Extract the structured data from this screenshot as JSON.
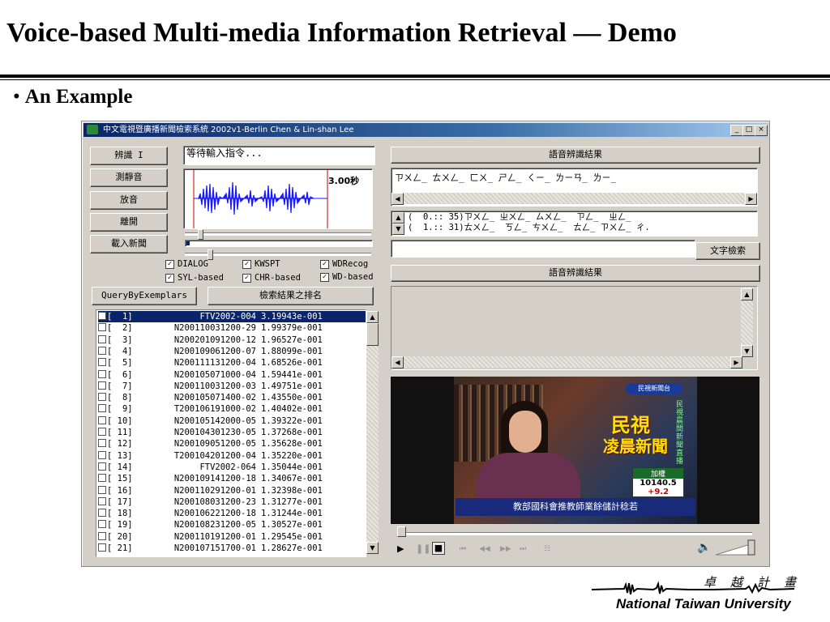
{
  "slide": {
    "title": "Voice-based Multi-media Information Retrieval — Demo",
    "bullet": "An Example"
  },
  "window": {
    "title": "中文電視暨廣播新聞檢索系統 2002v1-Berlin Chen & Lin-shan Lee",
    "controls": {
      "minimize": "_",
      "maximize": "□",
      "close": "×"
    }
  },
  "left_buttons": {
    "recognize": "辨識 I",
    "measure_silence": "測靜音",
    "play": "放音",
    "exit": "離開",
    "load_news": "載入新聞"
  },
  "status_text": "等待輸入指令...",
  "waveform": {
    "duration_label": "3.00秒"
  },
  "checkboxes": [
    {
      "label": "DIALOG",
      "checked": true
    },
    {
      "label": "KWSPT",
      "checked": true
    },
    {
      "label": "WDRecog",
      "checked": true
    },
    {
      "label": "SYL-based",
      "checked": true
    },
    {
      "label": "CHR-based",
      "checked": true
    },
    {
      "label": "WD-based",
      "checked": true
    }
  ],
  "query_button": "QueryByExemplars",
  "sort_button": "檢索結果之排名",
  "results": [
    {
      "n": "[  1]",
      "name": "FTV2002-004",
      "score": "3.19943e-001",
      "selected": true
    },
    {
      "n": "[  2]",
      "name": "N200110031200-29",
      "score": "1.99379e-001"
    },
    {
      "n": "[  3]",
      "name": "N200201091200-12",
      "score": "1.96527e-001"
    },
    {
      "n": "[  4]",
      "name": "N200109061200-07",
      "score": "1.88099e-001"
    },
    {
      "n": "[  5]",
      "name": "N200111131200-04",
      "score": "1.68526e-001"
    },
    {
      "n": "[  6]",
      "name": "N200105071000-04",
      "score": "1.59441e-001"
    },
    {
      "n": "[  7]",
      "name": "N200110031200-03",
      "score": "1.49751e-001"
    },
    {
      "n": "[  8]",
      "name": "N200105071400-02",
      "score": "1.43550e-001"
    },
    {
      "n": "[  9]",
      "name": "T200106191000-02",
      "score": "1.40402e-001"
    },
    {
      "n": "[ 10]",
      "name": "N200105142000-05",
      "score": "1.39322e-001"
    },
    {
      "n": "[ 11]",
      "name": "N200104301230-05",
      "score": "1.37268e-001"
    },
    {
      "n": "[ 12]",
      "name": "N200109051200-05",
      "score": "1.35628e-001"
    },
    {
      "n": "[ 13]",
      "name": "T200104201200-04",
      "score": "1.35220e-001"
    },
    {
      "n": "[ 14]",
      "name": "FTV2002-064",
      "score": "1.35044e-001"
    },
    {
      "n": "[ 15]",
      "name": "N200109141200-18",
      "score": "1.34067e-001"
    },
    {
      "n": "[ 16]",
      "name": "N200110291200-01",
      "score": "1.32398e-001"
    },
    {
      "n": "[ 17]",
      "name": "N200108031200-23",
      "score": "1.31277e-001"
    },
    {
      "n": "[ 18]",
      "name": "N200106221200-18",
      "score": "1.31244e-001"
    },
    {
      "n": "[ 19]",
      "name": "N200108231200-05",
      "score": "1.30527e-001"
    },
    {
      "n": "[ 20]",
      "name": "N200110191200-01",
      "score": "1.29545e-001"
    },
    {
      "n": "[ 21]",
      "name": "N200107151700-01",
      "score": "1.28627e-001"
    }
  ],
  "right": {
    "recog_header": "語音辨識結果",
    "zhuyin_line": "ㄗㄨㄥ_ ㄊㄨㄥ_ ㄈㄨ_ ㄕㄥ_ ㄑㄧ_ ㄌㄧㄢ_ ㄌㄧ_",
    "lattice_lines": [
      "(  0.:: 35)ㄗㄨㄥ_ ㄓㄨㄥ_ ㄙㄨㄥ_  ㄗㄥ_  ㄓㄥ_",
      "(  1.:: 31)ㄊㄨㄥ_  ㄎㄥ_ ㄘㄨㄥ_  ㄊㄥ_ ㄗㄨㄥ_ ㄔ."
    ],
    "search_input_value": "",
    "text_search_button": "文字檢索",
    "recog_header_2": "語音辨識結果"
  },
  "video": {
    "channel_badge": "民視新聞台",
    "program_title_line1": "民視",
    "program_title_line2": "凌晨新聞",
    "side_text": "民視晨間新聞直播",
    "ticker_label": "加權",
    "ticker_value": "10140.5",
    "ticker_change": "+9.2",
    "subtitle": "教部國科會推教師業餘儲計稔若"
  },
  "footer": {
    "university": "National Taiwan University",
    "motto": "卓越計畫"
  }
}
